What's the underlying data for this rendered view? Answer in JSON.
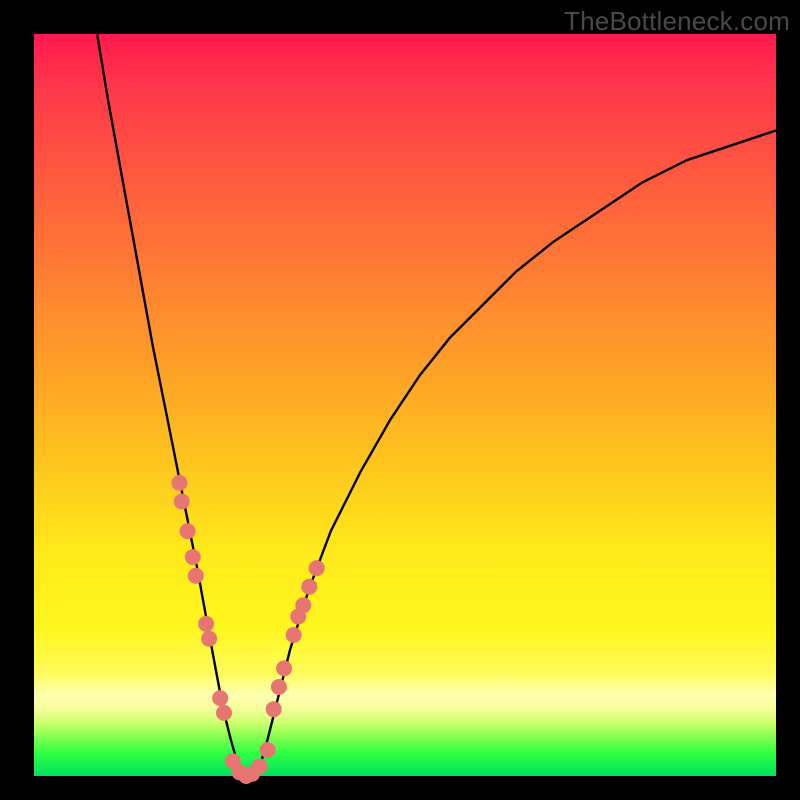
{
  "watermark": "TheBottleneck.com",
  "colors": {
    "frame": "#000000",
    "watermark_text": "#4a4a4a",
    "curve": "#000000",
    "dot": "#e77571"
  },
  "chart_data": {
    "type": "line",
    "title": "",
    "xlabel": "",
    "ylabel": "",
    "description": "Asymmetric V-shaped bottleneck curve with minimum near x≈0.29; steep left branch, shallower right branch. Scatter points cluster on both branches in the y≈0–30 band plus the flat bottom.",
    "xlim": [
      0,
      1
    ],
    "ylim": [
      0,
      100
    ],
    "series": [
      {
        "name": "bottleneck-curve",
        "type": "line",
        "x": [
          0.085,
          0.1,
          0.12,
          0.14,
          0.16,
          0.18,
          0.2,
          0.22,
          0.24,
          0.255,
          0.265,
          0.275,
          0.29,
          0.305,
          0.315,
          0.325,
          0.345,
          0.37,
          0.4,
          0.44,
          0.48,
          0.52,
          0.56,
          0.6,
          0.65,
          0.7,
          0.76,
          0.82,
          0.88,
          0.94,
          1.0
        ],
        "y": [
          100,
          91,
          80,
          69,
          58,
          48,
          38,
          28,
          17,
          9,
          5,
          1.5,
          0.0,
          1.5,
          5,
          9,
          17,
          25,
          33,
          41,
          48,
          54,
          59,
          63,
          68,
          72,
          76,
          80,
          83,
          85,
          87
        ]
      },
      {
        "name": "scatter-left-branch",
        "type": "scatter",
        "x": [
          0.196,
          0.199,
          0.207,
          0.214,
          0.218,
          0.232,
          0.236,
          0.251,
          0.256
        ],
        "y": [
          39.5,
          37,
          33,
          29.5,
          27,
          20.5,
          18.5,
          10.5,
          8.5
        ]
      },
      {
        "name": "scatter-bottom",
        "type": "scatter",
        "x": [
          0.268,
          0.277,
          0.286,
          0.294,
          0.304,
          0.315
        ],
        "y": [
          2.0,
          0.5,
          0.0,
          0.3,
          1.3,
          3.5
        ]
      },
      {
        "name": "scatter-right-branch",
        "type": "scatter",
        "x": [
          0.323,
          0.33,
          0.337,
          0.35,
          0.356,
          0.363,
          0.371,
          0.381
        ],
        "y": [
          9,
          12,
          14.5,
          19,
          21.5,
          23,
          25.5,
          28
        ]
      }
    ]
  }
}
